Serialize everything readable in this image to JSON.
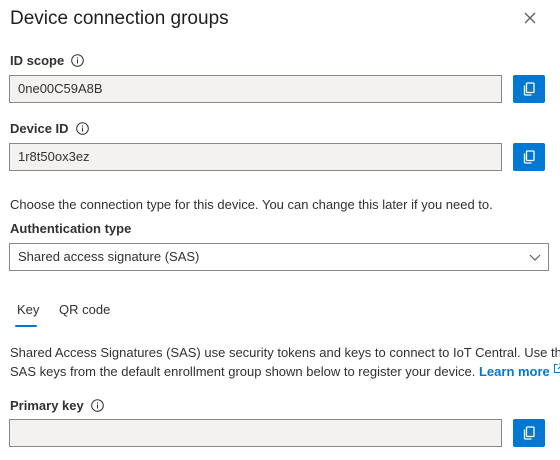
{
  "panel": {
    "title": "Device connection groups"
  },
  "id_scope": {
    "label": "ID scope",
    "value": "0ne00C59A8B"
  },
  "device_id": {
    "label": "Device ID",
    "value": "1r8t50ox3ez"
  },
  "connection": {
    "description": "Choose the connection type for this device. You can change this later if you need to."
  },
  "auth_type": {
    "label": "Authentication type",
    "selected": "Shared access signature (SAS)"
  },
  "tabs": [
    {
      "label": "Key",
      "selected": true
    },
    {
      "label": "QR code",
      "selected": false
    }
  ],
  "sas": {
    "line1": "Shared Access Signatures (SAS) use security tokens and keys to connect to IoT Central. Use the",
    "line2": "SAS keys from the default enrollment group shown below to register your device.",
    "link_label": "Learn more"
  },
  "primary_key": {
    "label": "Primary key",
    "value": ""
  },
  "icons": {
    "close": "close-icon",
    "info": "info-icon",
    "copy": "copy-icon",
    "chevron": "chevron-down-icon",
    "external": "external-link-icon"
  },
  "colors": {
    "accent": "#0078d4",
    "field_bg": "#f3f2f1",
    "border": "#8a8886"
  }
}
